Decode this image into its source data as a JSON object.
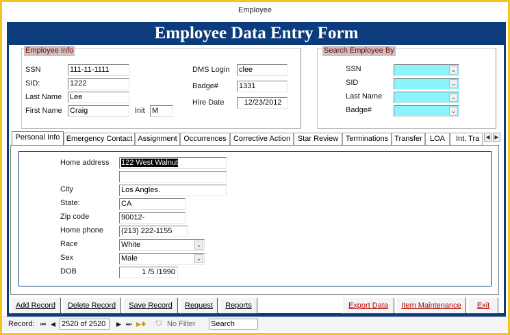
{
  "window": {
    "title": "Employee"
  },
  "form": {
    "header": "Employee Data Entry Form"
  },
  "employee_info": {
    "title": "Employee Info",
    "ssn_label": "SSN",
    "ssn": "111-11-1111",
    "sid_label": "SID:",
    "sid": "1222",
    "last_name_label": "Last Name",
    "last_name": "Lee",
    "first_name_label": "First Name",
    "first_name": "Craig",
    "init_label": "Init",
    "init": "M",
    "dms_login_label": "DMS Login",
    "dms_login": "clee",
    "badge_label": "Badge#",
    "badge": "1331",
    "hire_date_label": "Hire Date",
    "hire_date": "12/23/2012"
  },
  "search": {
    "title": "Search Employee By",
    "ssn_label": "SSN",
    "sid_label": "SID",
    "last_name_label": "Last Name",
    "badge_label": "Badge#",
    "field_color": "#8ef4fb"
  },
  "tabs": [
    "Personal Info",
    "Emergency Contact",
    "Assignment",
    "Occurrences",
    "Corrective Action",
    "Star Review",
    "Terminations",
    "Transfer",
    "LOA",
    "Int. Tra"
  ],
  "active_tab": "Personal Info",
  "personal": {
    "home_address_label": "Home address",
    "home_address": "122 West Walnut",
    "home_address_2": "",
    "city_label": "City",
    "city": "Los Angles.",
    "state_label": "State:",
    "state": "CA",
    "zip_label": "Zip code",
    "zip": "90012-",
    "phone_label": "Home phone",
    "phone": "(213) 222-1155",
    "race_label": "Race",
    "race": "White",
    "sex_label": "Sex",
    "sex": "Male",
    "dob_label": "DOB",
    "dob": "1 /5 /1990"
  },
  "buttons": {
    "add": "Add Record",
    "delete": "Delete Record",
    "save": "Save Record",
    "request": "Request",
    "reports": "Reports",
    "export": "Export Data",
    "item_maintenance": "Item Maintenance",
    "exit": "Exit"
  },
  "navigation": {
    "record_label": "Record:",
    "position": "2520 of 2520",
    "filter": "No Filter",
    "search_placeholder": "Search"
  },
  "colors": {
    "header_bg": "#0d3c7d",
    "frame": "#f2c61f",
    "group_title_bg": "#ccc0c0",
    "group_title_text": "#7a0000"
  }
}
